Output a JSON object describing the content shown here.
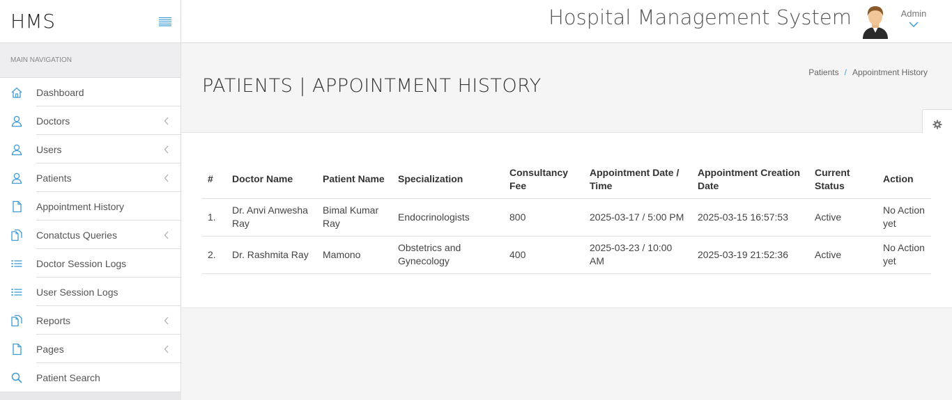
{
  "brand": {
    "name": "HMS"
  },
  "sidebar": {
    "header": "MAIN NAVIGATION",
    "items": [
      {
        "label": "Dashboard",
        "icon": "home-icon",
        "has_submenu": false
      },
      {
        "label": "Doctors",
        "icon": "user-icon",
        "has_submenu": true
      },
      {
        "label": "Users",
        "icon": "user-icon",
        "has_submenu": true
      },
      {
        "label": "Patients",
        "icon": "user-icon",
        "has_submenu": true
      },
      {
        "label": "Appointment History",
        "icon": "file-icon",
        "has_submenu": false
      },
      {
        "label": "Conatctus Queries",
        "icon": "files-icon",
        "has_submenu": true
      },
      {
        "label": "Doctor Session Logs",
        "icon": "list-icon",
        "has_submenu": false
      },
      {
        "label": "User Session Logs",
        "icon": "list-icon",
        "has_submenu": false
      },
      {
        "label": "Reports",
        "icon": "files-icon",
        "has_submenu": true
      },
      {
        "label": "Pages",
        "icon": "file-icon",
        "has_submenu": true
      },
      {
        "label": "Patient Search",
        "icon": "search-icon",
        "has_submenu": false
      }
    ]
  },
  "header": {
    "title": "Hospital Management System",
    "user": "Admin"
  },
  "page": {
    "title": "PATIENTS | APPOINTMENT HISTORY",
    "breadcrumb": [
      "Patients",
      "Appointment History"
    ]
  },
  "table": {
    "headers": {
      "index": "#",
      "doctor": "Doctor Name",
      "patient": "Patient Name",
      "specialization": "Specialization",
      "fee": "Consultancy Fee",
      "appt_datetime": "Appointment Date / Time",
      "created": "Appointment Creation Date",
      "status": "Current Status",
      "action": "Action"
    },
    "rows": [
      {
        "index": "1.",
        "doctor": "Dr. Anvi Anwesha Ray",
        "patient": "Bimal Kumar Ray",
        "specialization": "Endocrinologists",
        "fee": "800",
        "appt_datetime": "2025-03-17 / 5:00 PM",
        "created": "2025-03-15 16:57:53",
        "status": "Active",
        "action": "No Action yet"
      },
      {
        "index": "2.",
        "doctor": "Dr. Rashmita Ray",
        "patient": "Mamono",
        "specialization": "Obstetrics and Gynecology",
        "fee": "400",
        "appt_datetime": "2025-03-23 / 10:00 AM",
        "created": "2025-03-19 21:52:36",
        "status": "Active",
        "action": "No Action yet"
      }
    ]
  },
  "colors": {
    "accent": "#3d9ad6",
    "sidebar_header_bg": "#eeeef0"
  }
}
